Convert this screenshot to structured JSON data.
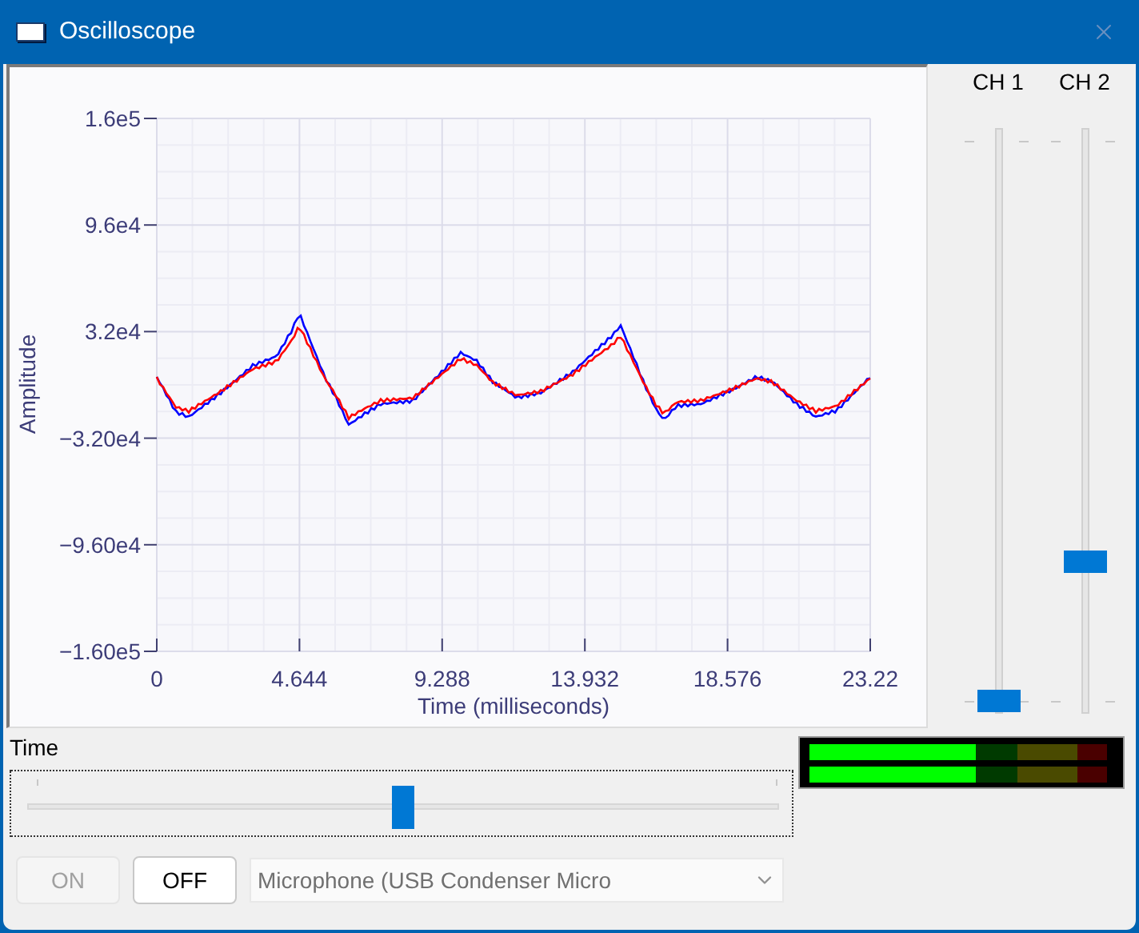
{
  "window": {
    "title": "Oscilloscope"
  },
  "plot": {
    "ylabel": "Amplitude",
    "xlabel": "Time (milliseconds)",
    "yticks": [
      "1.6e5",
      "9.6e4",
      "3.2e4",
      "−3.20e4",
      "−9.60e4",
      "−1.60e5"
    ],
    "xticks": [
      "0",
      "4.644",
      "9.288",
      "13.932",
      "18.576",
      "23.22"
    ],
    "traces": [
      {
        "color": "#0000ff"
      },
      {
        "color": "#ff0000"
      }
    ]
  },
  "channels": [
    {
      "label": "CH 1",
      "level": 0
    },
    {
      "label": "CH 2",
      "level": 0.25
    }
  ],
  "time": {
    "label": "Time",
    "level": 0.5
  },
  "meters": [
    {
      "level": 0.56
    },
    {
      "level": 0.56
    }
  ],
  "buttons": [
    {
      "label": "ON",
      "disabled": true
    },
    {
      "label": "OFF",
      "disabled": false
    }
  ],
  "source": {
    "value": "Microphone (USB Condenser Micro",
    "disabled": true
  }
}
